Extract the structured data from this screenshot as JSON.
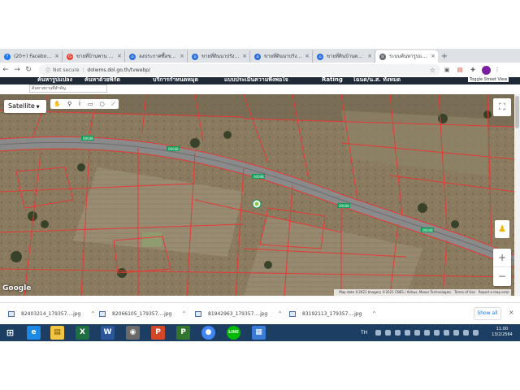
{
  "browser": {
    "tabs": [
      {
        "label": "(20+) Facebook",
        "icon": "facebook-icon",
        "color": "#1877f2",
        "active": false
      },
      {
        "label": "ขายที่บ้านพาน ตะเคียน",
        "icon": "google-icon",
        "color": "#ea4335",
        "active": false
      },
      {
        "label": "ลงประกาศซื้อขายที่ดิน",
        "icon": "home-icon",
        "color": "#2a6fdb",
        "active": false
      },
      {
        "label": "ขายที่ดินนาปรัง ตัวโค้ง",
        "icon": "home-icon",
        "color": "#2a6fdb",
        "active": false
      },
      {
        "label": "ขายที่ดินนาปรัง ตัวโค้ง",
        "icon": "home-icon",
        "color": "#2a6fdb",
        "active": false
      },
      {
        "label": "ขายที่ดินบ้านตะพาน",
        "icon": "home-icon",
        "color": "#2a6fdb",
        "active": false
      },
      {
        "label": "ระบบค้นหารูปแปลงที่ดิน",
        "icon": "globe-icon",
        "color": "#5f6368",
        "active": true
      }
    ],
    "new_tab": "+",
    "address": {
      "security": "Not secure",
      "url": "dolwms.dol.go.th/tvwebp/"
    }
  },
  "site": {
    "nav": [
      "ค้นหารูปแปลง",
      "ค้นหาด้วยพิกัด",
      "บริการกำหนดหมุด",
      "แบบประเมินความพึงพอใจ",
      "Rating",
      "โฉนด/น.ส. ทั้งหมด"
    ],
    "street_view_label": "Toggle Street View",
    "search_placeholder": "ค้นหาสถานที่สำคัญ"
  },
  "map": {
    "type_control": "Satellite",
    "logo": "Google",
    "attribution": [
      "Map data ©2021 Imagery ©2021 CNES / Airbus, Maxar Technologies",
      "Terms of Use",
      "Report a map error"
    ],
    "zoom_in": "+",
    "zoom_out": "−",
    "road_labels": [
      "00048",
      "00048",
      "00048",
      "00048",
      "00048"
    ],
    "accent": "#e53935",
    "road_color": "#8a8a8a",
    "label_color": "#0f9d58"
  },
  "downloads": {
    "items": [
      "82403214_179357....jpg",
      "82066105_179357....jpg",
      "81942963_179357....jpg",
      "83192113_179357....jpg"
    ],
    "show_all": "Show all",
    "close": "×"
  },
  "taskbar": {
    "apps": [
      {
        "icon": "windows-start-icon",
        "color": "#1c3e63"
      },
      {
        "icon": "internet-explorer-icon",
        "color": "#1e88e5"
      },
      {
        "icon": "file-explorer-icon",
        "color": "#f4c542"
      },
      {
        "icon": "excel-icon",
        "color": "#1d6f42"
      },
      {
        "icon": "word-icon",
        "color": "#2b579a"
      },
      {
        "icon": "disk-icon",
        "color": "#6a6a6a"
      },
      {
        "icon": "powerpoint-icon",
        "color": "#d24726"
      },
      {
        "icon": "project-icon",
        "color": "#31752f"
      },
      {
        "icon": "chrome-icon",
        "color": "#4285f4"
      },
      {
        "icon": "line-icon",
        "color": "#00b900"
      },
      {
        "icon": "photos-icon",
        "color": "#3a7bd5"
      }
    ],
    "language": "TH",
    "time": "11:00",
    "date": "13/2/2564"
  }
}
